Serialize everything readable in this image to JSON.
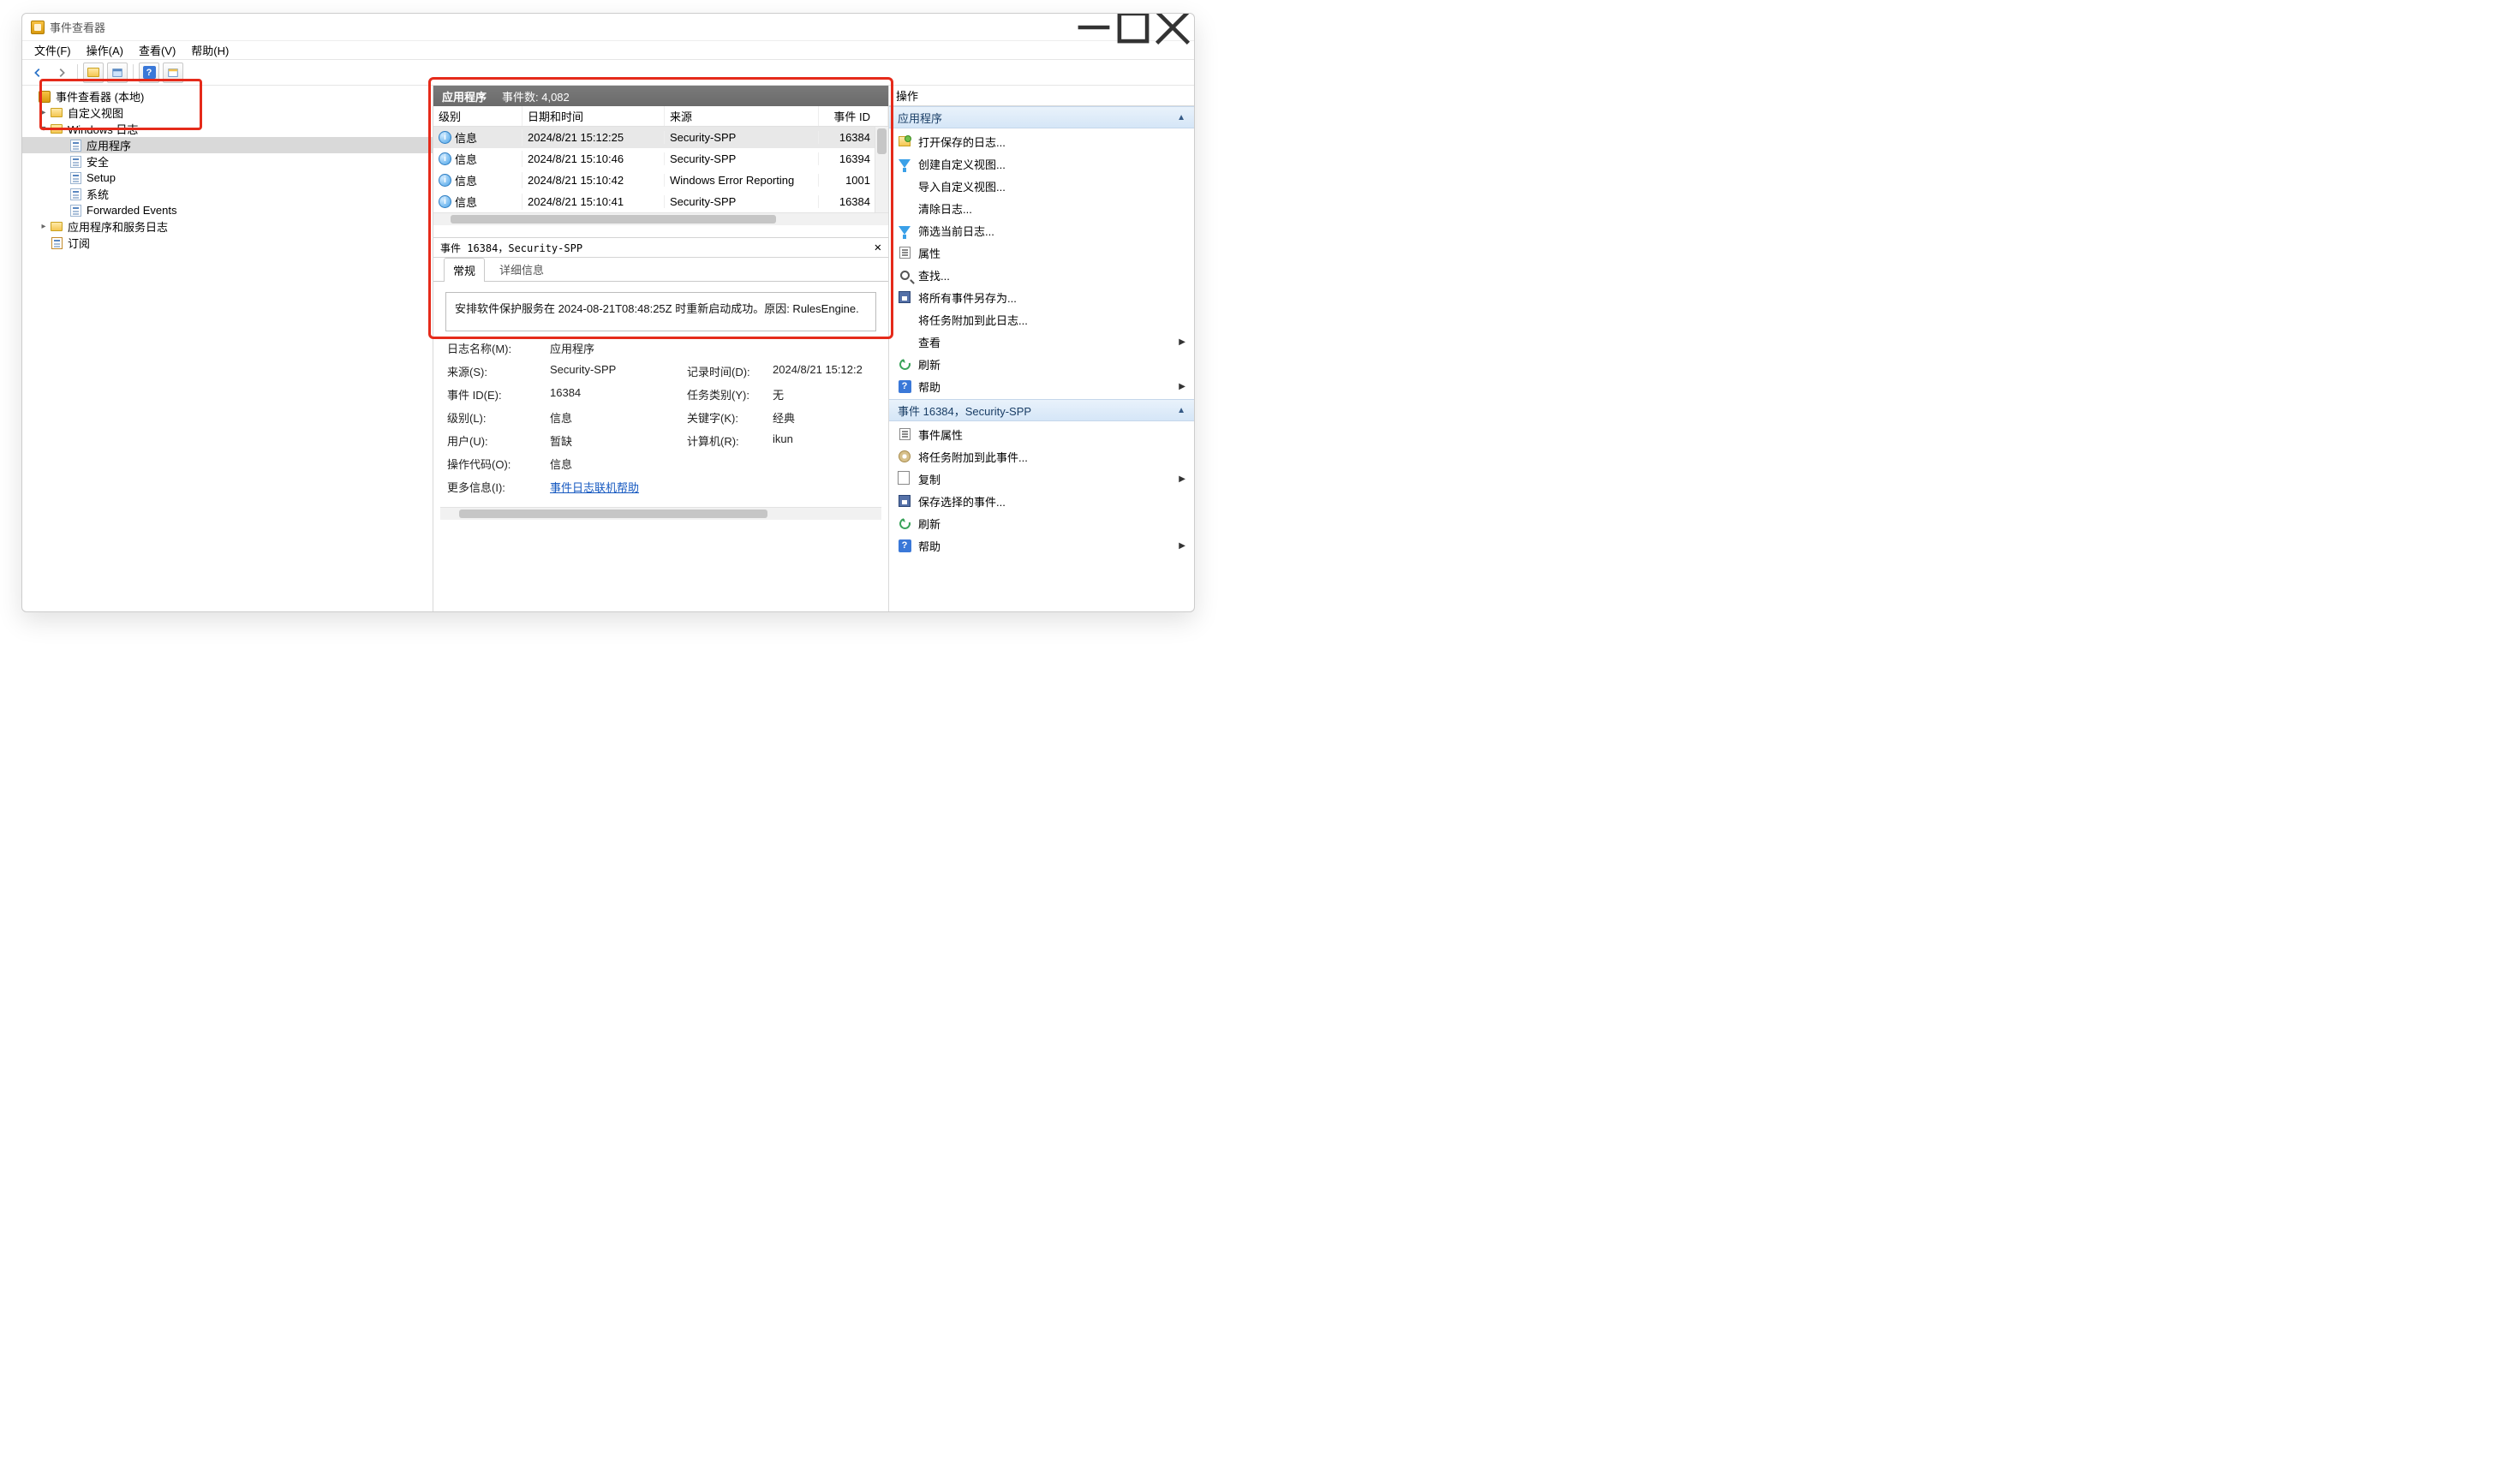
{
  "window": {
    "title": "事件查看器"
  },
  "menu": {
    "file": "文件(F)",
    "action": "操作(A)",
    "view": "查看(V)",
    "help": "帮助(H)"
  },
  "tree": {
    "root": "事件查看器 (本地)",
    "custom_views": "自定义视图",
    "windows_logs": "Windows 日志",
    "application": "应用程序",
    "security": "安全",
    "setup": "Setup",
    "system": "系统",
    "forwarded": "Forwarded Events",
    "app_service": "应用程序和服务日志",
    "subscriptions": "订阅"
  },
  "list": {
    "title": "应用程序",
    "count_label": "事件数: 4,082",
    "cols": {
      "level": "级别",
      "date": "日期和时间",
      "source": "来源",
      "id": "事件 ID"
    },
    "rows": [
      {
        "level": "信息",
        "date": "2024/8/21 15:12:25",
        "source": "Security-SPP",
        "id": "16384"
      },
      {
        "level": "信息",
        "date": "2024/8/21 15:10:46",
        "source": "Security-SPP",
        "id": "16394"
      },
      {
        "level": "信息",
        "date": "2024/8/21 15:10:42",
        "source": "Windows Error Reporting",
        "id": "1001"
      },
      {
        "level": "信息",
        "date": "2024/8/21 15:10:41",
        "source": "Security-SPP",
        "id": "16384"
      }
    ]
  },
  "detail": {
    "header": "事件 16384，Security-SPP",
    "tabs": {
      "general": "常规",
      "details": "详细信息"
    },
    "message": "安排软件保护服务在 2024-08-21T08:48:25Z 时重新启动成功。原因: RulesEngine.",
    "fields": {
      "log_name_l": "日志名称(M):",
      "log_name_v": "应用程序",
      "source_l": "来源(S):",
      "source_v": "Security-SPP",
      "logged_l": "记录时间(D):",
      "logged_v": "2024/8/21 15:12:2",
      "eventid_l": "事件 ID(E):",
      "eventid_v": "16384",
      "taskcat_l": "任务类别(Y):",
      "taskcat_v": "无",
      "level_l": "级别(L):",
      "level_v": "信息",
      "keywords_l": "关键字(K):",
      "keywords_v": "经典",
      "user_l": "用户(U):",
      "user_v": "暂缺",
      "computer_l": "计算机(R):",
      "computer_v": "ikun",
      "opcode_l": "操作代码(O):",
      "opcode_v": "信息",
      "moreinfo_l": "更多信息(I):",
      "moreinfo_link": "事件日志联机帮助"
    }
  },
  "actions": {
    "title": "操作",
    "section1": "应用程序",
    "items1": {
      "open_saved": "打开保存的日志...",
      "create_view": "创建自定义视图...",
      "import_view": "导入自定义视图...",
      "clear_log": "清除日志...",
      "filter_log": "筛选当前日志...",
      "properties": "属性",
      "find": "查找...",
      "save_all": "将所有事件另存为...",
      "attach_task": "将任务附加到此日志...",
      "view": "查看",
      "refresh": "刷新",
      "help": "帮助"
    },
    "section2": "事件 16384，Security-SPP",
    "items2": {
      "event_props": "事件属性",
      "attach_event": "将任务附加到此事件...",
      "copy": "复制",
      "save_sel": "保存选择的事件...",
      "refresh": "刷新",
      "help": "帮助"
    }
  }
}
